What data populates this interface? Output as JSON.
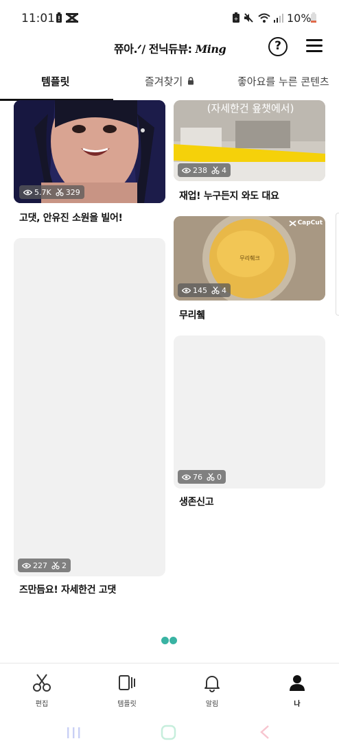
{
  "status_bar": {
    "time": "11:01",
    "battery_pct": "10%"
  },
  "header": {
    "title": "쮸아.ᐟ/ 전닉듀뷰:",
    "signature": "Ming",
    "help_symbol": "?"
  },
  "tabs": [
    {
      "label": "템플릿",
      "active": true
    },
    {
      "label": "즐겨찾기",
      "active": false
    },
    {
      "label": "좋아요를 누른 콘텐츠",
      "active": false
    }
  ],
  "cards": [
    {
      "views": "5.7K",
      "uses": "329",
      "caption": "고댓, 안유진 소원을 빌어!"
    },
    {
      "views": "227",
      "uses": "2",
      "caption": "즈만듬요! 자세한건 고댓"
    },
    {
      "views": "238",
      "uses": "4",
      "caption": "재업! 누구든지 와도 대요",
      "overlay_text": "(자세한건 욮챗에서)"
    },
    {
      "views": "145",
      "uses": "4",
      "caption": "무리췤",
      "watermark": "CapCut",
      "overlay_text": "무리췌크"
    },
    {
      "views": "76",
      "uses": "0",
      "caption": "생존신고"
    }
  ],
  "bottom_nav": [
    {
      "label": "편집",
      "icon": "scissors-icon",
      "active": false
    },
    {
      "label": "템플릿",
      "icon": "template-icon",
      "active": false
    },
    {
      "label": "알림",
      "icon": "bell-icon",
      "active": false
    },
    {
      "label": "나",
      "icon": "person-icon",
      "active": true
    }
  ],
  "colors": {
    "accent": "#39b3a3",
    "placeholder": "#f1f1f1",
    "yellow_banner": "#f5d10a"
  }
}
